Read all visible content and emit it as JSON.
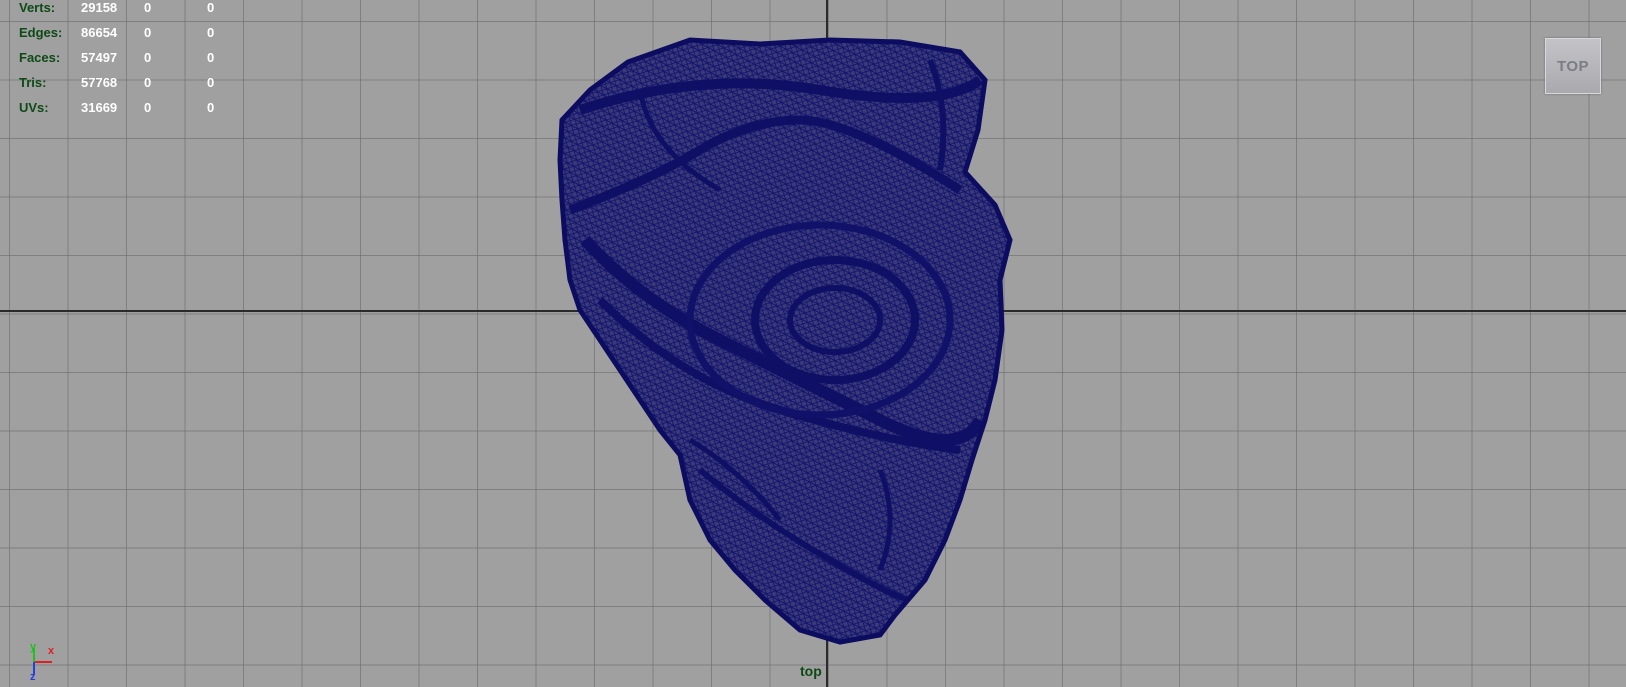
{
  "viewport": {
    "camera_name": "top",
    "view_cube_label": "TOP",
    "mesh_name": "rock-wireframe",
    "mesh_color": "#1a1a7a",
    "mesh_fill": "#3c3c7a"
  },
  "hud": {
    "rows": [
      {
        "label": "Verts:",
        "v1": "29158",
        "v2": "0",
        "v3": "0"
      },
      {
        "label": "Edges:",
        "v1": "86654",
        "v2": "0",
        "v3": "0"
      },
      {
        "label": "Faces:",
        "v1": "57497",
        "v2": "0",
        "v3": "0"
      },
      {
        "label": "Tris:",
        "v1": "57768",
        "v2": "0",
        "v3": "0"
      },
      {
        "label": "UVs:",
        "v1": "31669",
        "v2": "0",
        "v3": "0"
      }
    ]
  },
  "axis_gizmo": {
    "x_label": "x",
    "y_label": "y",
    "z_label": "z",
    "x_color": "#e02020",
    "y_color": "#20c020",
    "z_color": "#2040e0"
  }
}
